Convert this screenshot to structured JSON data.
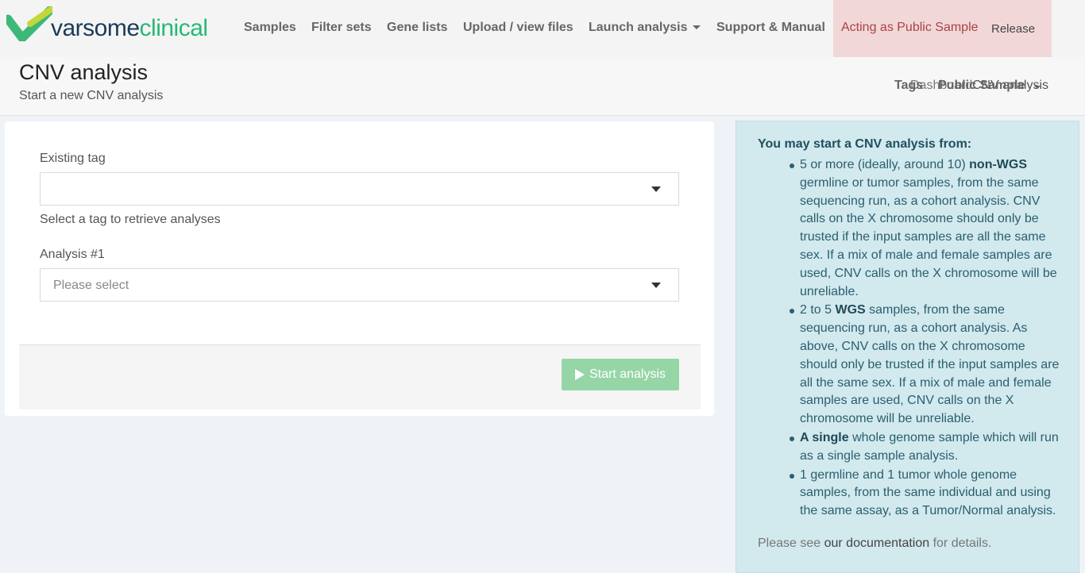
{
  "navbar": {
    "logo": {
      "part1": "varsome",
      "part2": "clinical"
    },
    "items": [
      {
        "label": "Samples"
      },
      {
        "label": "Filter sets"
      },
      {
        "label": "Gene lists"
      },
      {
        "label": "Upload / view files"
      },
      {
        "label": "Launch analysis"
      },
      {
        "label": "Support & Manual"
      }
    ],
    "acting_label": "Acting as Public Sample",
    "release_label": "Release"
  },
  "header": {
    "title": "CNV analysis",
    "subtitle": "Start a new CNV analysis",
    "breadcrumb": {
      "dashboard": "Dashboard",
      "current": "CNV analysis",
      "tags": "Tags",
      "public_sample": "Public Sample"
    }
  },
  "form": {
    "existing_tag_label": "Existing tag",
    "existing_tag_value": "",
    "existing_tag_help": "Select a tag to retrieve analyses",
    "analysis_label": "Analysis #1",
    "analysis_placeholder": "Please select",
    "start_button": "Start analysis"
  },
  "info": {
    "title": "You may start a CNV analysis from:",
    "items": [
      {
        "pre": "5 or more (ideally, around 10) ",
        "bold": "non-WGS",
        "post": " germline or tumor samples, from the same sequencing run, as a cohort analysis. CNV calls on the X chromosome should only be trusted if the input samples are all the same sex. If a mix of male and female samples are used, CNV calls on the X chromosome will be unreliable."
      },
      {
        "pre": "2 to 5 ",
        "bold": "WGS",
        "post": " samples, from the same sequencing run, as a cohort analysis. As above, CNV calls on the X chromosome should only be trusted if the input samples are all the same sex. If a mix of male and female samples are used, CNV calls on the X chromosome will be unreliable."
      },
      {
        "pre": "",
        "bold": "A single",
        "post": " whole genome sample which will run as a single sample analysis."
      },
      {
        "pre": "1 germline and 1 tumor whole genome samples, from the same individual and using the same assay, as a Tumor/Normal analysis.",
        "bold": "",
        "post": ""
      }
    ],
    "footer_pre": "Please see ",
    "footer_link": "our documentation",
    "footer_post": " for details."
  },
  "colors": {
    "brand_green": "#27b878",
    "brand_navy": "#1b3a5a",
    "acting_bg": "#f2d7d9",
    "info_bg": "#d2e9ee",
    "start_button_bg": "#96d6a6"
  }
}
